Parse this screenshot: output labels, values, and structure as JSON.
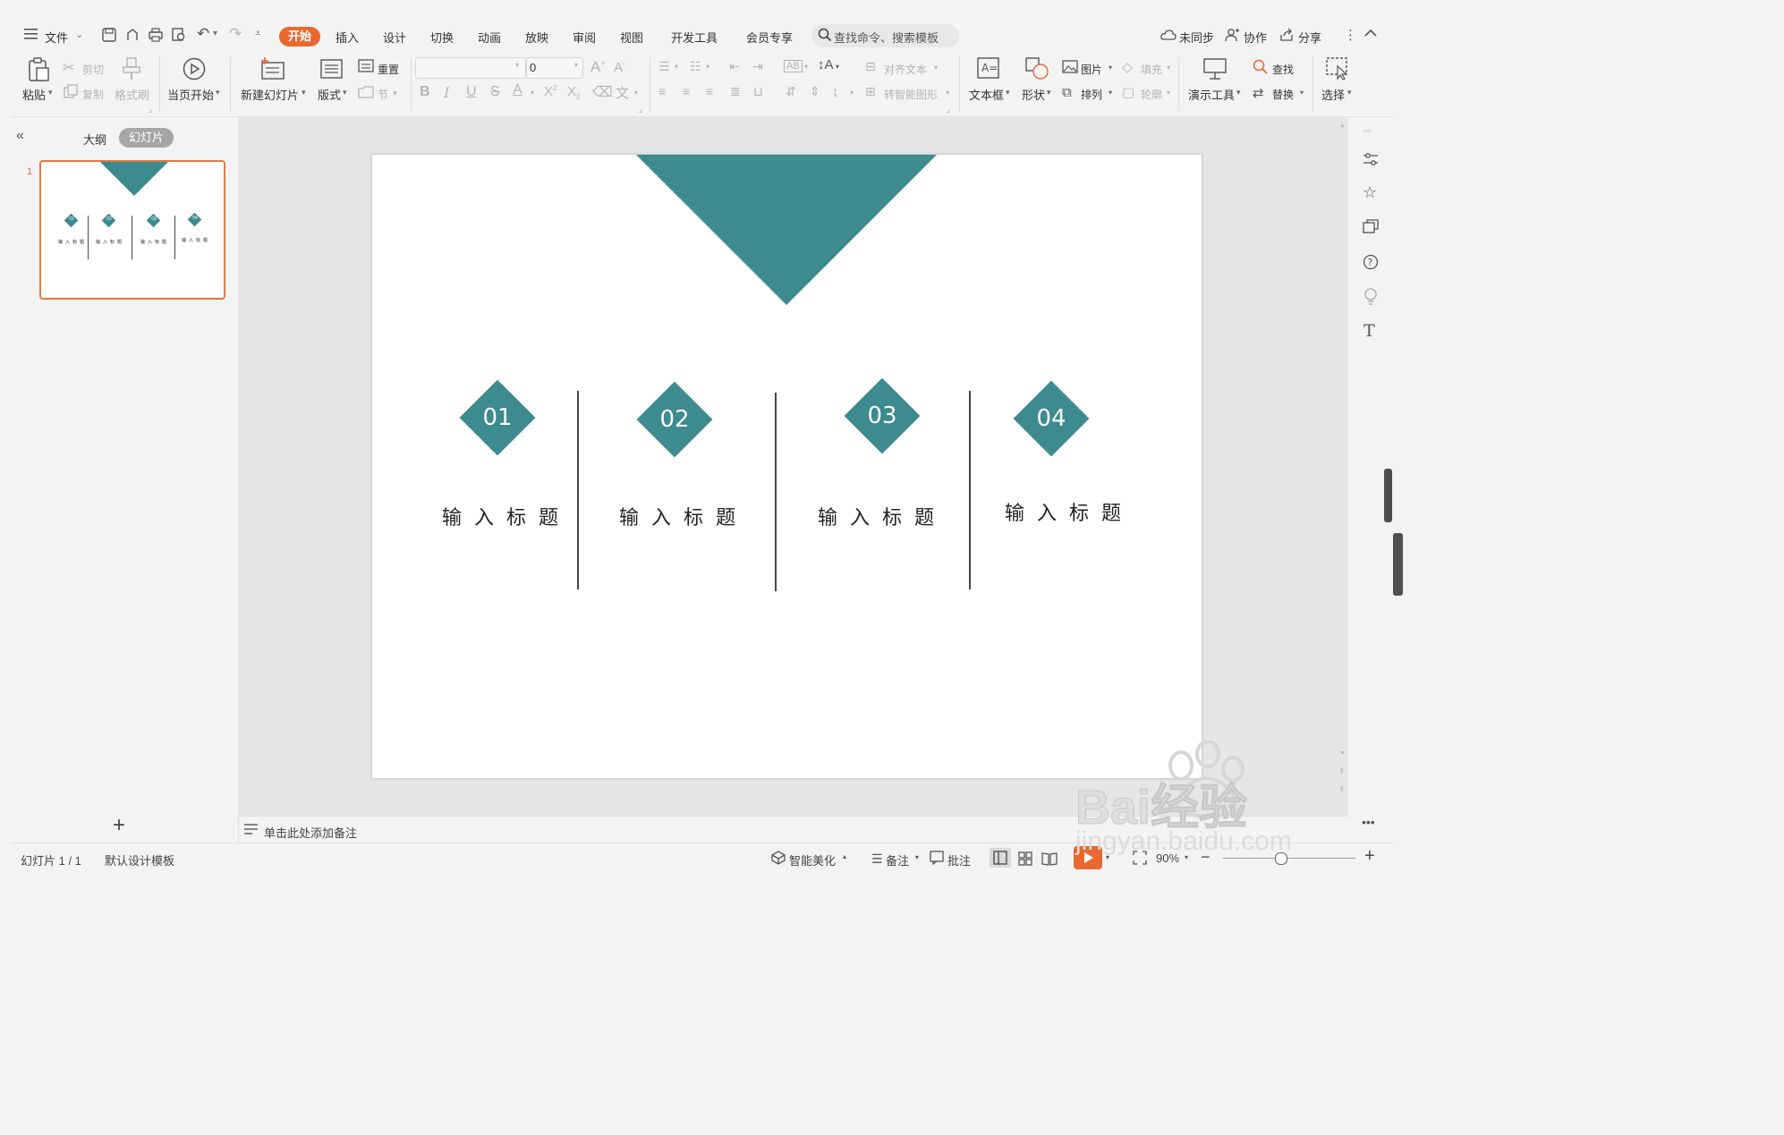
{
  "menu": {
    "file": "文件",
    "tabs": [
      "开始",
      "插入",
      "设计",
      "切换",
      "动画",
      "放映",
      "审阅",
      "视图",
      "开发工具",
      "会员专享"
    ],
    "active_tab": "开始",
    "search_placeholder": "查找命令、搜索模板",
    "sync": "未同步",
    "collab": "协作",
    "share": "分享"
  },
  "ribbon": {
    "paste": "粘贴",
    "cut": "剪切",
    "copy": "复制",
    "format_painter": "格式刷",
    "play_from_current": "当页开始",
    "new_slide": "新建幻灯片",
    "layout": "版式",
    "reset": "重置",
    "section": "节",
    "font_size": "0",
    "align_text": "对齐文本",
    "smart_graphic": "转智能图形",
    "textbox": "文本框",
    "shape": "形状",
    "picture": "图片",
    "arrange": "排列",
    "fill": "填充",
    "outline": "轮廓",
    "presentation_tools": "演示工具",
    "find": "查找",
    "replace": "替换",
    "select": "选择"
  },
  "left_panel": {
    "outline_tab": "大纲",
    "slides_tab": "幻灯片",
    "slide_number": "1",
    "thumb_items": [
      {
        "num": "01",
        "title": "输入标题"
      },
      {
        "num": "02",
        "title": "输入标题"
      },
      {
        "num": "03",
        "title": "输入标题"
      },
      {
        "num": "04",
        "title": "输入标题"
      }
    ]
  },
  "slide": {
    "accent_color": "#3d8a8f",
    "items": [
      {
        "num": "01",
        "title": "输入标题"
      },
      {
        "num": "02",
        "title": "输入标题"
      },
      {
        "num": "03",
        "title": "输入标题"
      },
      {
        "num": "04",
        "title": "输入标题"
      }
    ]
  },
  "notes": {
    "placeholder": "单击此处添加备注"
  },
  "status": {
    "slide_count": "幻灯片 1 / 1",
    "template": "默认设计模板",
    "beautify": "智能美化",
    "notes": "备注",
    "comments": "批注",
    "zoom": "90%"
  },
  "watermark": {
    "brand": "Bai经验",
    "url": "jingyan.baidu.com"
  }
}
